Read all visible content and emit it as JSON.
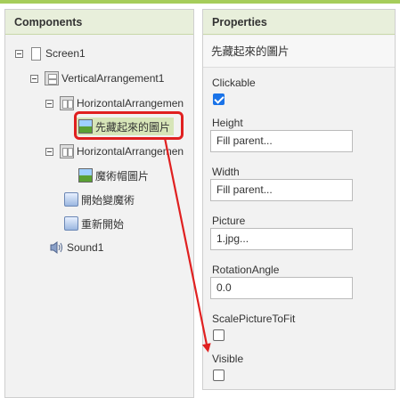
{
  "components_panel": {
    "title": "Components",
    "tree": [
      {
        "label": "Screen1",
        "icon": "screen-icon"
      },
      {
        "label": "VerticalArrangement1",
        "icon": "vertical-arrangement-icon"
      },
      {
        "label": "HorizontalArrangemen",
        "icon": "horizontal-arrangement-icon"
      },
      {
        "label": "先藏起來的圖片",
        "icon": "image-icon",
        "selected": true
      },
      {
        "label": "HorizontalArrangemen",
        "icon": "horizontal-arrangement-icon"
      },
      {
        "label": "魔術帽圖片",
        "icon": "image-icon"
      },
      {
        "label": "開始變魔術",
        "icon": "button-icon"
      },
      {
        "label": "重新開始",
        "icon": "button-icon"
      },
      {
        "label": "Sound1",
        "icon": "speaker-icon"
      }
    ]
  },
  "properties_panel": {
    "title": "Properties",
    "component_name": "先藏起來的圖片",
    "props": {
      "clickable": {
        "label": "Clickable",
        "checked": true
      },
      "height": {
        "label": "Height",
        "value": "Fill parent..."
      },
      "width": {
        "label": "Width",
        "value": "Fill parent..."
      },
      "picture": {
        "label": "Picture",
        "value": "1.jpg..."
      },
      "rotation": {
        "label": "RotationAngle",
        "value": "0.0"
      },
      "scale": {
        "label": "ScalePictureToFit",
        "checked": false
      },
      "visible": {
        "label": "Visible",
        "checked": false
      }
    }
  },
  "colors": {
    "accent": "#a6cd5b",
    "highlight": "#e02020",
    "selection": "#d7e5b8",
    "checkbox": "#1a73e8"
  }
}
